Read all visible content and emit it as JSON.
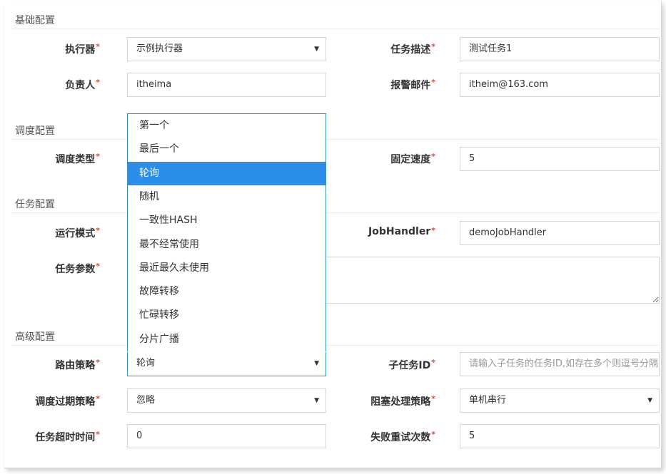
{
  "sections": {
    "basic": "基础配置",
    "schedule": "调度配置",
    "task": "任务配置",
    "advanced": "高级配置"
  },
  "required_mark": "*",
  "basic": {
    "executor": {
      "label": "执行器",
      "value": "示例执行器"
    },
    "description": {
      "label": "任务描述",
      "value": "测试任务1"
    },
    "owner": {
      "label": "负责人",
      "value": "itheima"
    },
    "alarm_email": {
      "label": "报警邮件",
      "value": "itheim@163.com"
    }
  },
  "schedule": {
    "type": {
      "label": "调度类型"
    },
    "fixed_rate": {
      "label": "固定速度",
      "value": "5"
    }
  },
  "task": {
    "run_mode": {
      "label": "运行模式"
    },
    "job_handler": {
      "label": "JobHandler",
      "value": "demoJobHandler"
    },
    "params": {
      "label": "任务参数",
      "value": ""
    }
  },
  "advanced": {
    "route": {
      "label": "路由策略",
      "value": "轮询"
    },
    "child_id": {
      "label": "子任务ID",
      "placeholder": "请输入子任务的任务ID,如存在多个则逗号分隔"
    },
    "misfire": {
      "label": "调度过期策略",
      "value": "忽略"
    },
    "block": {
      "label": "阻塞处理策略",
      "value": "单机串行"
    },
    "timeout": {
      "label": "任务超时时间",
      "value": "0"
    },
    "retry": {
      "label": "失败重试次数",
      "value": "5"
    }
  },
  "route_dropdown": {
    "options": [
      "第一个",
      "最后一个",
      "轮询",
      "随机",
      "一致性HASH",
      "最不经常使用",
      "最近最久未使用",
      "故障转移",
      "忙碌转移",
      "分片广播"
    ],
    "selected_index": 2
  },
  "colors": {
    "accent": "#3c8dbc",
    "selected_bg": "#2b8ee8",
    "required": "#dd4b39"
  }
}
